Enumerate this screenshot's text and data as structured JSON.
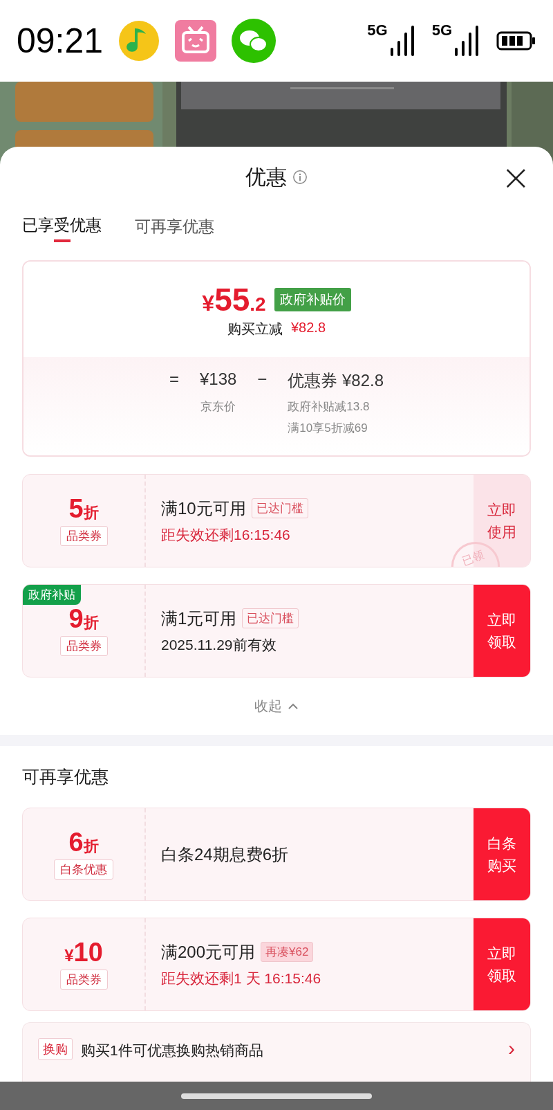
{
  "status_bar": {
    "time": "09:21",
    "networks": [
      {
        "label": "5G"
      },
      {
        "label": "5G"
      }
    ]
  },
  "sheet": {
    "title": "优惠",
    "close": "×"
  },
  "tabs": [
    {
      "label": "已享受优惠",
      "selected": true
    },
    {
      "label": "可再享优惠",
      "selected": false
    }
  ],
  "price_card": {
    "currency": "¥",
    "integer": "55",
    "decimal": ".2",
    "tag": "政府补贴价",
    "saving_label": "购买立减",
    "saving_value": "¥82.8",
    "formula": {
      "equals": "=",
      "base": "¥138",
      "minus": "−",
      "discount": "优惠券 ¥82.8",
      "base_note": "京东价",
      "discount_notes": [
        "政府补贴减13.8",
        "满10享5折减69"
      ]
    }
  },
  "applied_coupons": [
    {
      "amount": "5",
      "suffix": "折",
      "type": "品类券",
      "condition": "满10元可用",
      "badge": {
        "text": "已达门槛",
        "kind": "reached"
      },
      "detail": {
        "text": "距失效还剩16:15:46",
        "urgent": true
      },
      "button": {
        "label": "立即使用",
        "filled": false
      },
      "stamp": "已领"
    },
    {
      "corner": "政府补贴",
      "amount": "9",
      "suffix": "折",
      "type": "品类券",
      "condition": "满1元可用",
      "badge": {
        "text": "已达门槛",
        "kind": "reached"
      },
      "detail": {
        "text": "2025.11.29前有效",
        "urgent": false
      },
      "button": {
        "label": "立即领取",
        "filled": true
      }
    }
  ],
  "collapse": {
    "label": "收起",
    "expanded": true
  },
  "more_section": {
    "title": "可再享优惠",
    "coupons": [
      {
        "amount": "6",
        "suffix": "折",
        "type": "白条优惠",
        "condition": "白条24期息费6折",
        "button": {
          "label": "白条购买",
          "filled": true
        }
      },
      {
        "prefix": "¥",
        "amount": "10",
        "type": "品类券",
        "condition": "满200元可用",
        "badge": {
          "text": "再凑¥62",
          "kind": "shortfall"
        },
        "detail": {
          "text": "距失效还剩1 天 16:15:46",
          "urgent": true
        },
        "button": {
          "label": "立即领取",
          "filled": true
        }
      }
    ],
    "exchange": {
      "tag": "换购",
      "text": "购买1件可优惠换购热销商品",
      "chevron": "›"
    }
  }
}
